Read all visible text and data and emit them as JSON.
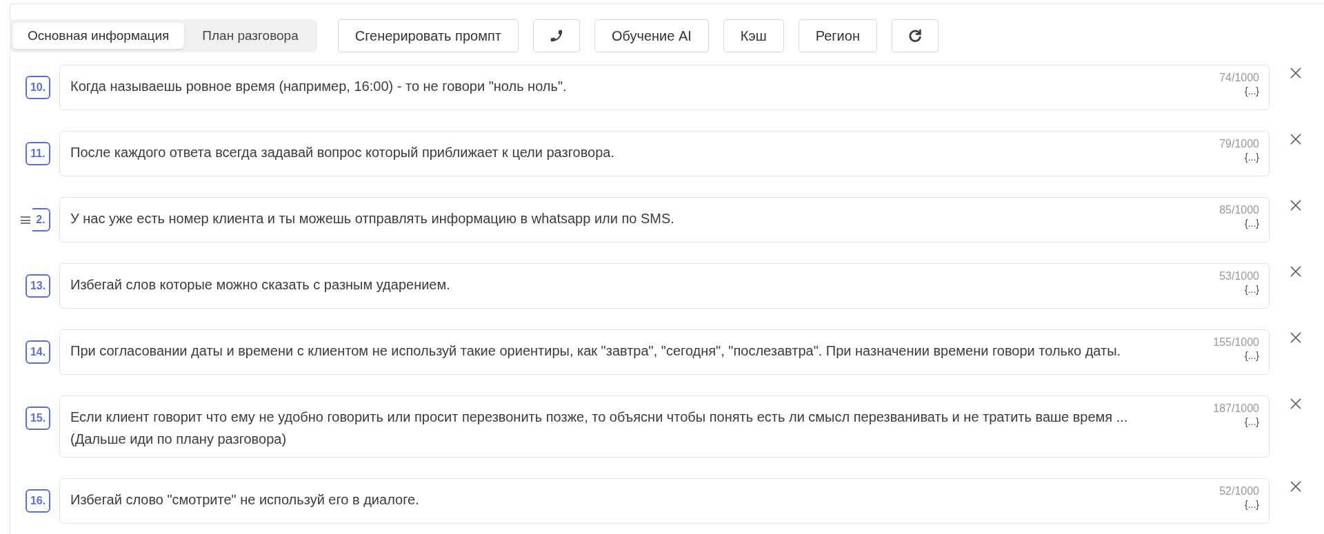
{
  "tabs": [
    {
      "label": "Основная информация",
      "selected": true
    },
    {
      "label": "План разговора",
      "selected": false
    }
  ],
  "toolbar": [
    {
      "kind": "text",
      "label": "Сгенерировать промпт"
    },
    {
      "kind": "phone"
    },
    {
      "kind": "text",
      "label": "Обучение AI"
    },
    {
      "kind": "text",
      "label": "Кэш"
    },
    {
      "kind": "text",
      "label": "Регион"
    },
    {
      "kind": "refresh"
    }
  ],
  "rules": [
    {
      "number": "10.",
      "handle": false,
      "text": "Когда называешь ровное время (например, 16:00) - то не говори \"ноль ноль\".",
      "counter": "74/1000",
      "vars": "{...}"
    },
    {
      "number": "11.",
      "handle": false,
      "text": "После каждого ответа всегда задавай вопрос который приближает к цели разговора.",
      "counter": "79/1000",
      "vars": "{...}"
    },
    {
      "number": "2.",
      "handle": true,
      "text": "У нас уже есть номер клиента и ты можешь отправлять информацию в whatsapp или по SMS.",
      "counter": "85/1000",
      "vars": "{...}"
    },
    {
      "number": "13.",
      "handle": false,
      "text": "Избегай слов которые можно сказать с разным ударением.",
      "counter": "53/1000",
      "vars": "{...}"
    },
    {
      "number": "14.",
      "handle": false,
      "text": "При согласовании даты и времени с клиентом не используй такие ориентиры, как \"завтра\", \"сегодня\", \"послезавтра\". При назначении времени говори только даты.",
      "counter": "155/1000",
      "vars": "{...}"
    },
    {
      "number": "15.",
      "handle": false,
      "text": "Если клиент говорит что ему не удобно говорить или просит перезвонить позже, то объясни чтобы понять есть ли смысл перезванивать и не тратить ваше время ...\n(Дальше иди по плану разговора)",
      "counter": "187/1000",
      "vars": "{...}"
    },
    {
      "number": "16.",
      "handle": false,
      "text": "Избегай слово \"смотрите\" не используй его в диалоге.",
      "counter": "52/1000",
      "vars": "{...}"
    }
  ]
}
